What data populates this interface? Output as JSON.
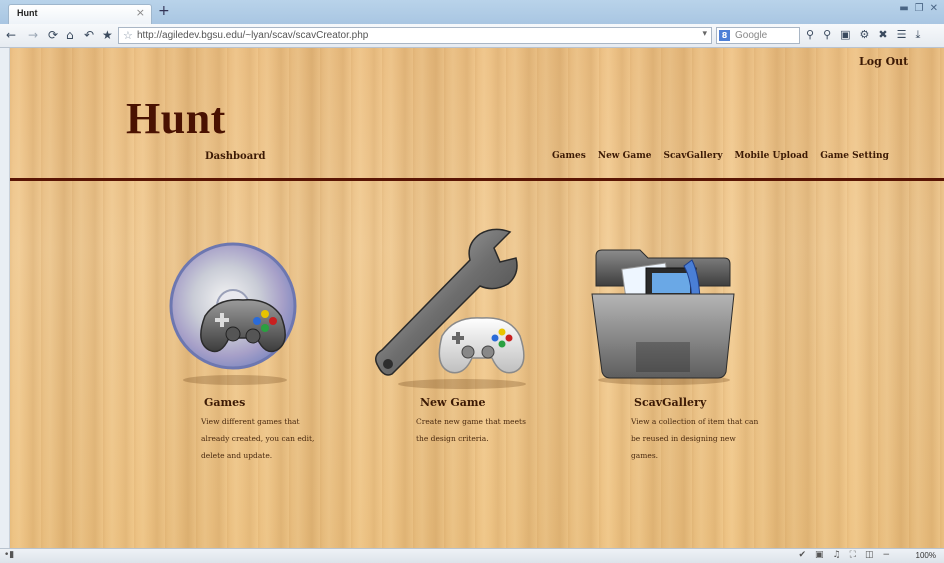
{
  "browser": {
    "tab_title": "Hunt",
    "tab_close": "×",
    "new_tab": "+",
    "url": "http://agiledev.bgsu.edu/~lyan/scav/scavCreator.php",
    "search_placeholder": "Google",
    "zoom": "100%"
  },
  "page": {
    "logout": "Log Out",
    "title": "Hunt",
    "dashboard": "Dashboard",
    "nav": [
      "Games",
      "New Game",
      "ScavGallery",
      "Mobile Upload",
      "Game Setting"
    ],
    "cards": [
      {
        "title": "Games",
        "description": "View different games that already created, you can edit, delete and update.",
        "icon": "game-disc-controller-icon"
      },
      {
        "title": "New Game",
        "description": "Create new game that meets the design criteria.",
        "icon": "wrench-controller-icon"
      },
      {
        "title": "ScavGallery",
        "description": "View a collection of item that can be reused in designing new games.",
        "icon": "media-folder-icon"
      }
    ]
  },
  "colors": {
    "title": "#4a1202",
    "divider": "#5a1505",
    "text": "#3c1a05"
  }
}
